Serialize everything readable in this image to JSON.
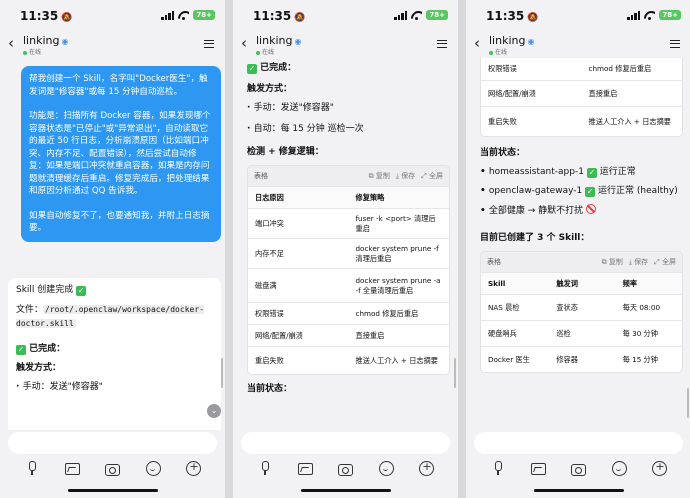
{
  "status": {
    "time": "11:35",
    "battery": "78+"
  },
  "header": {
    "title": "linking",
    "online": "在线"
  },
  "p1": {
    "user_p1": "帮我创建一个 Skill，名字叫\"Docker医生\"，触发词是\"修容器\"或每 15 分钟自动巡检。",
    "user_p2": "功能是：扫描所有 Docker 容器，如果发现哪个容器状态是\"已停止\"或\"异常退出\"，自动读取它的最近 50 行日志，分析崩溃原因（比如端口冲突、内存不足、配置错误），然后尝试自动修复：如果是端口冲突就重启容器，如果是内存问题就清理缓存后重启。修复完成后，把处理结果和原因分析通过 QQ 告诉我。",
    "user_p3": "如果自动修复不了，也要通知我，并附上日志摘要。",
    "bot_created": "Skill 创建完成",
    "file_label": "文件：",
    "file_path": "/root/.openclaw/workspace/docker-doctor.skill",
    "done": "已完成：",
    "trigger": "触发方式：",
    "manual": "手动：发送\"修容器\""
  },
  "p2": {
    "done": "已完成：",
    "trigger": "触发方式：",
    "manual": "手动：发送\"修容器\"",
    "auto": "自动：每 15 分钟 巡检一次",
    "detect": "检测 + 修复逻辑：",
    "current": "当前状态：",
    "table": {
      "label": "表格",
      "copy": "复制",
      "save": "保存",
      "full": "全屏",
      "headers": [
        "日志原因",
        "修复策略"
      ],
      "rows": [
        [
          "端口冲突",
          "fuser -k <port> 清理后重启"
        ],
        [
          "内存不足",
          "docker system prune -f 清理后重启"
        ],
        [
          "磁盘满",
          "docker system prune -a -f 全量清理后重启"
        ],
        [
          "权限错误",
          "chmod 修复后重启"
        ],
        [
          "网络/配置/崩溃",
          "直接重启"
        ],
        [
          "重启失败",
          "推送人工介入 + 日志摘要"
        ]
      ]
    }
  },
  "p3": {
    "top_rows": [
      [
        "权限错误",
        "chmod 修复后重启"
      ],
      [
        "网络/配置/崩溃",
        "直接重启"
      ],
      [
        "重启失败",
        "推送人工介入 + 日志摘要"
      ]
    ],
    "current": "当前状态：",
    "status1_name": "homeassistant-app-1",
    "status1_val": "运行正常",
    "status2_name": "openclaw-gateway-1",
    "status2_val": "运行正常 (healthy)",
    "status3": "全部健康 → 静默不打扰",
    "created": "目前已创建了 3 个 Skill：",
    "table": {
      "label": "表格",
      "copy": "复制",
      "save": "保存",
      "full": "全屏",
      "headers": [
        "Skill",
        "触发词",
        "频率"
      ],
      "rows": [
        [
          "NAS 晨检",
          "查状态",
          "每天 08:00"
        ],
        [
          "硬盘哨兵",
          "巡检",
          "每 30 分钟"
        ],
        [
          "Docker 医生",
          "修容器",
          "每 15 分钟"
        ]
      ]
    }
  }
}
